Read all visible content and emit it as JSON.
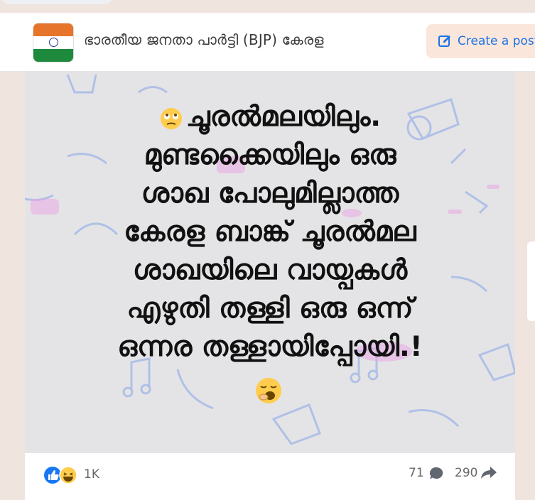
{
  "header": {
    "page_name": "ഭാരതീയ ജനതാ പാർട്ടി (BJP) കേരള",
    "create_post_label": "Create a post"
  },
  "post": {
    "text_lines": [
      "ചൂരൽമലയിലും.",
      "മുണ്ടക്കൈയിലും ഒരു",
      "ശാഖ പോലുമില്ലാത്ത",
      "കേരള ബാങ്ക് ചൂരൽമല",
      "ശാഖയിലെ വായ്പകൾ",
      "എഴുതി തള്ളി ഒരു ഒന്ന്",
      "ഒന്നര തള്ളായിപ്പോയി.!"
    ],
    "leading_emoji": "face-with-rolling-eyes-icon",
    "trailing_emoji": "yawning-face-icon"
  },
  "engagement": {
    "reactions": [
      "like-icon",
      "haha-icon"
    ],
    "reaction_count": "1K",
    "comment_count": "71",
    "share_count": "290"
  },
  "colors": {
    "accent": "#1b74e4",
    "create_bg": "#fbe6dc",
    "page_bg": "#f0e4df",
    "image_bg": "#e4e4e6"
  }
}
